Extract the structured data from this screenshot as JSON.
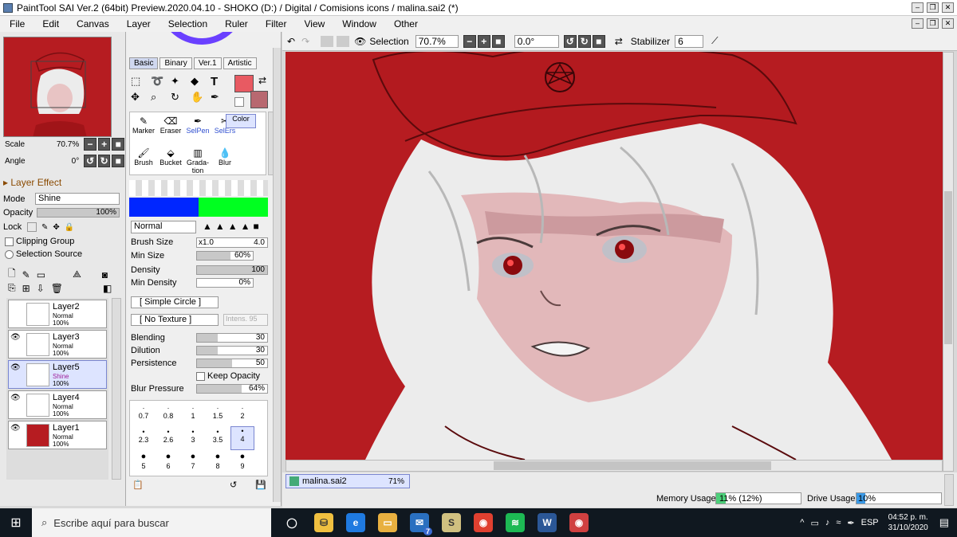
{
  "window": {
    "title": "PaintTool SAI Ver.2 (64bit) Preview.2020.04.10 - SHOKO (D:) / Digital / Comisions icons / malina.sai2 (*)"
  },
  "menu": [
    "File",
    "Edit",
    "Canvas",
    "Layer",
    "Selection",
    "Ruler",
    "Filter",
    "View",
    "Window",
    "Other"
  ],
  "navigator": {
    "scale_label": "Scale",
    "scale_value": "70.7%",
    "angle_label": "Angle",
    "angle_value": "0°"
  },
  "layer_effect": {
    "title": "Layer Effect",
    "mode_label": "Mode",
    "mode_value": "Shine",
    "opacity_label": "Opacity",
    "opacity_value": "100%",
    "opacity_fraction": 1.0,
    "lock_label": "Lock",
    "clipping_group": "Clipping Group",
    "selection_source": "Selection Source"
  },
  "layers": [
    {
      "name": "Layer2",
      "mode": "Normal",
      "opacity": "100%",
      "visible": false,
      "selected": false,
      "thumb": "#ffffff"
    },
    {
      "name": "Layer3",
      "mode": "Normal",
      "opacity": "100%",
      "visible": true,
      "selected": false,
      "thumb": "#ffffff"
    },
    {
      "name": "Layer5",
      "mode": "Shine",
      "opacity": "100%",
      "visible": true,
      "selected": true,
      "thumb": "#ffffff"
    },
    {
      "name": "Layer4",
      "mode": "Normal",
      "opacity": "100%",
      "visible": true,
      "selected": false,
      "thumb": "#ffffff"
    },
    {
      "name": "Layer1",
      "mode": "Normal",
      "opacity": "100%",
      "visible": true,
      "selected": false,
      "thumb": "#b61c21"
    }
  ],
  "tool_tabs": [
    "Basic",
    "Binary",
    "Ver.1",
    "Artistic"
  ],
  "colors": {
    "primary": "#e85a62",
    "secondary": "#b86870",
    "blue": "#0026ff",
    "green": "#00ff20",
    "canvas": "#b61c21"
  },
  "brushes": [
    "Marker",
    "Eraser",
    "SelPen",
    "SelErs",
    "Brush",
    "Bucket",
    "Grada-tion",
    "Blur",
    "Color"
  ],
  "blend_mode": "Normal",
  "brush_settings": {
    "brush_size_label": "Brush Size",
    "brush_size_mult": "x1.0",
    "brush_size_value": "4.0",
    "min_size_label": "Min Size",
    "min_size_value": "60%",
    "density_label": "Density",
    "density_value": "100",
    "min_density_label": "Min Density",
    "min_density_value": "0%",
    "shape": "[ Simple Circle ]",
    "texture": "[ No Texture ]",
    "intens_label": "Intens.",
    "intens_value": "95",
    "blending_label": "Blending",
    "blending_value": "30",
    "dilution_label": "Dilution",
    "dilution_value": "30",
    "persistence_label": "Persistence",
    "persistence_value": "50",
    "keep_opacity": "Keep Opacity",
    "blur_pressure_label": "Blur Pressure",
    "blur_pressure_value": "64%"
  },
  "size_presets": [
    "0.7",
    "0.8",
    "1",
    "1.5",
    "2",
    "2.3",
    "2.6",
    "3",
    "3.5",
    "4",
    "5",
    "6",
    "7",
    "8",
    "9"
  ],
  "canvas_toolbar": {
    "selection_label": "Selection",
    "zoom": "70.7%",
    "angle": "0.0°",
    "stabilizer_label": "Stabilizer",
    "stabilizer_value": "6"
  },
  "document": {
    "name": "malina.sai2",
    "zoom": "71%"
  },
  "status": {
    "memory_label": "Memory Usage",
    "memory_value": "11% (12%)",
    "drive_label": "Drive Usage",
    "drive_value": "10%"
  },
  "taskbar": {
    "search_placeholder": "Escribe aquí para buscar",
    "lang": "ESP",
    "time": "04:52 p. m.",
    "date": "31/10/2020",
    "mail_badge": "7"
  }
}
